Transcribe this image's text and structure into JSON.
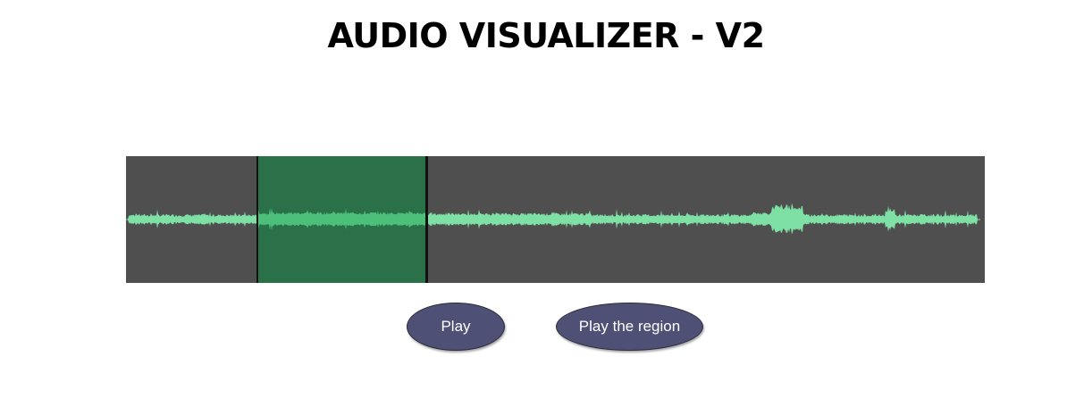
{
  "header": {
    "title": "AUDIO VISUALIZER - V2"
  },
  "waveform": {
    "background_color": "#4f4f4f",
    "wave_color": "#7fe0a5",
    "region_color": "#2a7049",
    "region_wave_color": "#4cbf7a",
    "region_start_fraction": 0.153,
    "region_end_fraction": 0.35
  },
  "controls": {
    "play_label": "Play",
    "play_region_label": "Play the region",
    "button_color": "#4e5075"
  }
}
